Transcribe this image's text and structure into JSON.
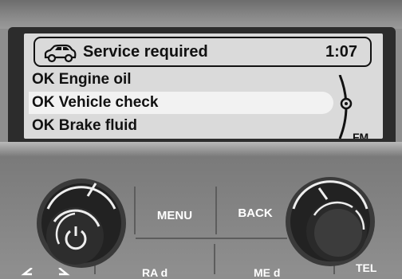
{
  "display": {
    "header": {
      "icon": "car-icon",
      "title": "Service required",
      "clock": "1:07"
    },
    "items": [
      {
        "label": "OK Engine oil",
        "selected": false
      },
      {
        "label": "OK Vehicle check",
        "selected": true
      },
      {
        "label": "OK Brake fluid",
        "selected": false
      }
    ],
    "band": "FM"
  },
  "controls": {
    "menu_label": "MENU",
    "back_label": "BACK",
    "power_icon": "power-icon",
    "bottom_left_icons": [
      "arrow-left-icon",
      "arrow-right-icon"
    ],
    "bottom_labels": [
      "RA d",
      "ME d",
      "TEL"
    ]
  },
  "colors": {
    "screen_bg": "#dadada",
    "selected_row": "#f2f2f2",
    "text": "#111111"
  }
}
